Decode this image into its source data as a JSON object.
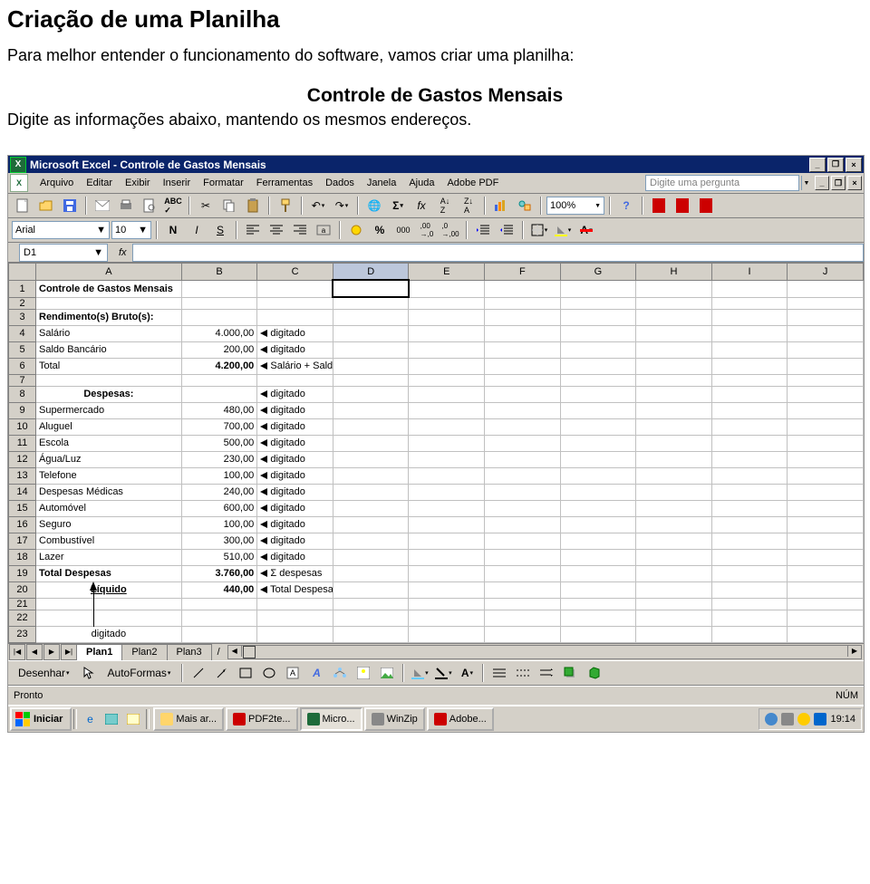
{
  "doc": {
    "title": "Criação de uma Planilha",
    "para1": "Para melhor entender o funcionamento do software, vamos criar uma planilha:",
    "center": "Controle de Gastos Mensais",
    "line2": "Digite as informações abaixo, mantendo os mesmos endereços."
  },
  "titlebar": {
    "text": "Microsoft Excel - Controle de Gastos Mensais"
  },
  "menu": {
    "items": [
      "Arquivo",
      "Editar",
      "Exibir",
      "Inserir",
      "Formatar",
      "Ferramentas",
      "Dados",
      "Janela",
      "Ajuda",
      "Adobe PDF"
    ],
    "askbox": "Digite uma pergunta"
  },
  "toolbar1": {
    "zoom": "100%"
  },
  "toolbar2": {
    "font": "Arial",
    "size": "10"
  },
  "formula": {
    "namebox": "D1",
    "fx": "fx"
  },
  "columns": [
    "A",
    "B",
    "C",
    "D",
    "E",
    "F",
    "G",
    "H",
    "I",
    "J"
  ],
  "rows": [
    {
      "n": "1",
      "a": "Controle de Gastos Mensais",
      "bold": true
    },
    {
      "n": "2",
      "small": true
    },
    {
      "n": "3",
      "a": "Rendimento(s) Bruto(s):",
      "bold": true
    },
    {
      "n": "4",
      "a": "Salário",
      "b": "4.000,00",
      "c": "digitado",
      "arrow": true
    },
    {
      "n": "5",
      "a": "Saldo Bancário",
      "b": "200,00",
      "c": "digitado",
      "arrow": true
    },
    {
      "n": "6",
      "a": "Total",
      "b": "4.200,00",
      "c": "Salário + Saldo Bancário",
      "bold_b": true,
      "arrow": true
    },
    {
      "n": "7",
      "small": true
    },
    {
      "n": "8",
      "a": "Despesas:",
      "a_center_bold": true,
      "c": "digitado",
      "arrow": true
    },
    {
      "n": "9",
      "a": "Supermercado",
      "b": "480,00",
      "c": "digitado",
      "arrow": true
    },
    {
      "n": "10",
      "a": "Aluguel",
      "b": "700,00",
      "c": "digitado",
      "arrow": true
    },
    {
      "n": "11",
      "a": "Escola",
      "b": "500,00",
      "c": "digitado",
      "arrow": true
    },
    {
      "n": "12",
      "a": "Água/Luz",
      "b": "230,00",
      "c": "digitado",
      "arrow": true
    },
    {
      "n": "13",
      "a": "Telefone",
      "b": "100,00",
      "c": "digitado",
      "arrow": true
    },
    {
      "n": "14",
      "a": "Despesas Médicas",
      "b": "240,00",
      "c": "digitado",
      "arrow": true
    },
    {
      "n": "15",
      "a": "Automóvel",
      "b": "600,00",
      "c": "digitado",
      "arrow": true
    },
    {
      "n": "16",
      "a": "Seguro",
      "b": "100,00",
      "c": "digitado",
      "arrow": true
    },
    {
      "n": "17",
      "a": "Combustível",
      "b": "300,00",
      "c": "digitado",
      "arrow": true
    },
    {
      "n": "18",
      "a": "Lazer",
      "b": "510,00",
      "c": "digitado",
      "arrow": true
    },
    {
      "n": "19",
      "a": "Total Despesas",
      "b": "3.760,00",
      "c": "Σ despesas",
      "bold": true,
      "bold_b": true,
      "arrow": true
    },
    {
      "n": "20",
      "a": "Líquido",
      "a_center_bold": true,
      "a_underline": true,
      "b": "440,00",
      "c": "Total Despesas -Líquido",
      "bold_b": true,
      "arrow": true
    },
    {
      "n": "21",
      "small": true
    },
    {
      "n": "22"
    },
    {
      "n": "23",
      "a": "digitado",
      "a_center": true,
      "up_arrow": true
    }
  ],
  "tabs": {
    "sheets": [
      "Plan1",
      "Plan2",
      "Plan3"
    ]
  },
  "drawbar": {
    "draw": "Desenhar",
    "auto": "AutoFormas"
  },
  "status": {
    "left": "Pronto",
    "num": "NÚM"
  },
  "taskbar": {
    "start": "Iniciar",
    "items": [
      "Mais ar...",
      "PDF2te...",
      "Micro...",
      "WinZip",
      "Adobe..."
    ],
    "clock": "19:14"
  }
}
